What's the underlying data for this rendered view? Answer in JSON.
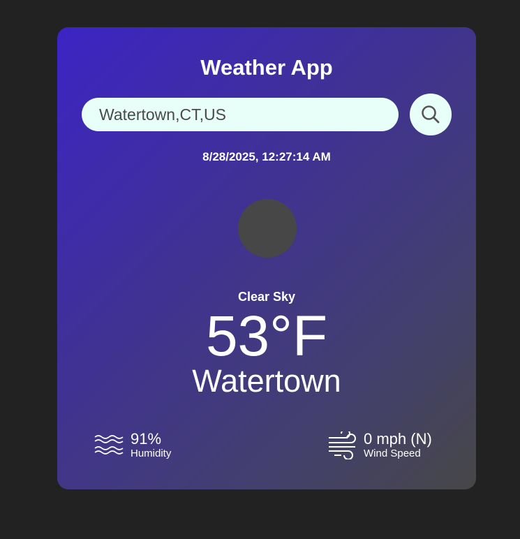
{
  "app": {
    "title": "Weather App"
  },
  "search": {
    "value": "Watertown,CT,US"
  },
  "icons": {
    "search": "search-icon",
    "weather": "weather-icon",
    "humidity": "humidity-icon",
    "wind": "wind-icon"
  },
  "weather": {
    "datetime": "8/28/2025, 12:27:14 AM",
    "description": "Clear Sky",
    "temperature": "53°F",
    "city": "Watertown"
  },
  "stats": {
    "humidity": {
      "value": "91%",
      "label": "Humidity"
    },
    "wind": {
      "value": "0 mph (N)",
      "label": "Wind Speed"
    }
  },
  "colors": {
    "page_background": "#222222",
    "card_gradient_start": "#3c24c4",
    "card_gradient_end": "#474747",
    "input_background": "#e8fff9",
    "text": "#ffffff"
  }
}
